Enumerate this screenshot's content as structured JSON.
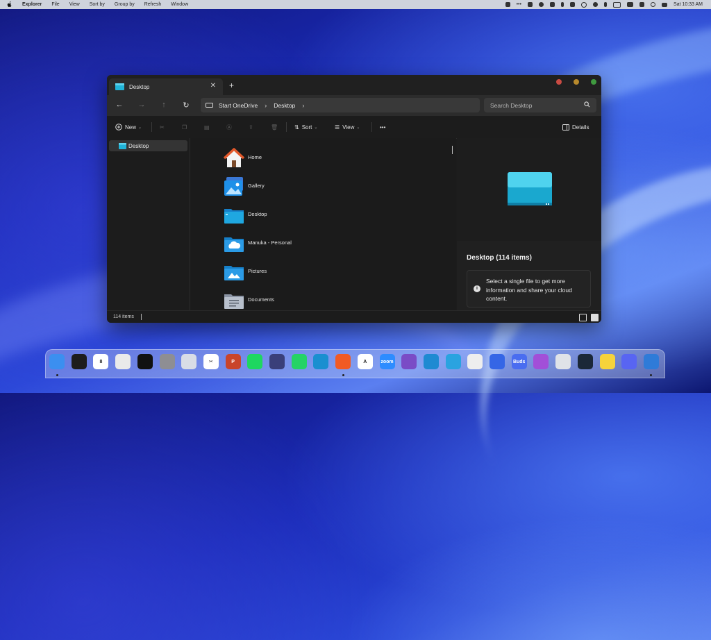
{
  "menubar": {
    "apple": "",
    "app": "Explorer",
    "items": [
      "File",
      "View",
      "Sort by",
      "Group by",
      "Refresh",
      "Window"
    ],
    "clock": "Sat 10:33 AM"
  },
  "window": {
    "tab": {
      "title": "Desktop",
      "close": "✕",
      "new_tab": "+"
    },
    "traffic_colors": {
      "close": "#c94b43",
      "minimize": "#b7892c",
      "zoom": "#3f9a3f"
    },
    "nav": {
      "back": "←",
      "forward": "→",
      "up": "↑",
      "refresh": "↻"
    },
    "address": {
      "crumbs": [
        "Start OneDrive",
        "Desktop"
      ],
      "sep": "›"
    },
    "search": {
      "placeholder": "Search Desktop"
    },
    "toolbar": {
      "new_label": "New",
      "sort_label": "Sort",
      "view_label": "View",
      "more_label": "•••",
      "details_label": "Details"
    },
    "sidebar": {
      "items": [
        {
          "label": "Desktop"
        }
      ]
    },
    "files": [
      {
        "name": "Home",
        "icon": "home-icon"
      },
      {
        "name": "Gallery",
        "icon": "gallery-icon"
      },
      {
        "name": "Desktop",
        "icon": "desktop-folder-icon"
      },
      {
        "name": "Manuka - Personal",
        "icon": "onedrive-folder-icon"
      },
      {
        "name": "Pictures",
        "icon": "pictures-folder-icon"
      },
      {
        "name": "Documents",
        "icon": "documents-folder-icon"
      }
    ],
    "preview": {
      "title": "Desktop (114 items)",
      "info_icon": "i",
      "info_text": "Select a single file to get more information and share your cloud content."
    },
    "status": {
      "count": "114 items"
    }
  },
  "dock": {
    "apps": [
      {
        "name": "finder",
        "color": "#3b8ff0"
      },
      {
        "name": "widgets",
        "color": "#1d1d1d"
      },
      {
        "name": "calendar",
        "color": "#ffffff",
        "label": "8"
      },
      {
        "name": "launchpad",
        "color": "#eaeaea"
      },
      {
        "name": "clock",
        "color": "#111111"
      },
      {
        "name": "system-settings",
        "color": "#8e8e93"
      },
      {
        "name": "trash",
        "color": "#d9dde6"
      },
      {
        "name": "capcut",
        "color": "#ffffff",
        "label": "✂"
      },
      {
        "name": "powerpoint",
        "color": "#c9442a",
        "label": "P"
      },
      {
        "name": "spotify",
        "color": "#1ed760"
      },
      {
        "name": "linear",
        "color": "#3a3f7a"
      },
      {
        "name": "whatsapp",
        "color": "#25d366"
      },
      {
        "name": "edge",
        "color": "#1a8fd0"
      },
      {
        "name": "brave",
        "color": "#f15a24"
      },
      {
        "name": "arc",
        "color": "#ffffff",
        "label": "A"
      },
      {
        "name": "zoom",
        "color": "#2d8cff",
        "label": "zoom"
      },
      {
        "name": "visual-studio",
        "color": "#7a4cc6"
      },
      {
        "name": "vscode",
        "color": "#1f8ad2"
      },
      {
        "name": "telegram",
        "color": "#2aa3e0"
      },
      {
        "name": "chrome",
        "color": "#eeeeee"
      },
      {
        "name": "activity-monitor",
        "color": "#3566e6"
      },
      {
        "name": "buds",
        "color": "#4a6df0",
        "label": "Buds"
      },
      {
        "name": "podcasts",
        "color": "#a24fd8"
      },
      {
        "name": "calculator",
        "color": "#e0e3e8"
      },
      {
        "name": "steam",
        "color": "#1b2838"
      },
      {
        "name": "stickies",
        "color": "#f5d33b"
      },
      {
        "name": "discord",
        "color": "#5865f2"
      },
      {
        "name": "notepad",
        "color": "#2f7bd8"
      }
    ]
  }
}
